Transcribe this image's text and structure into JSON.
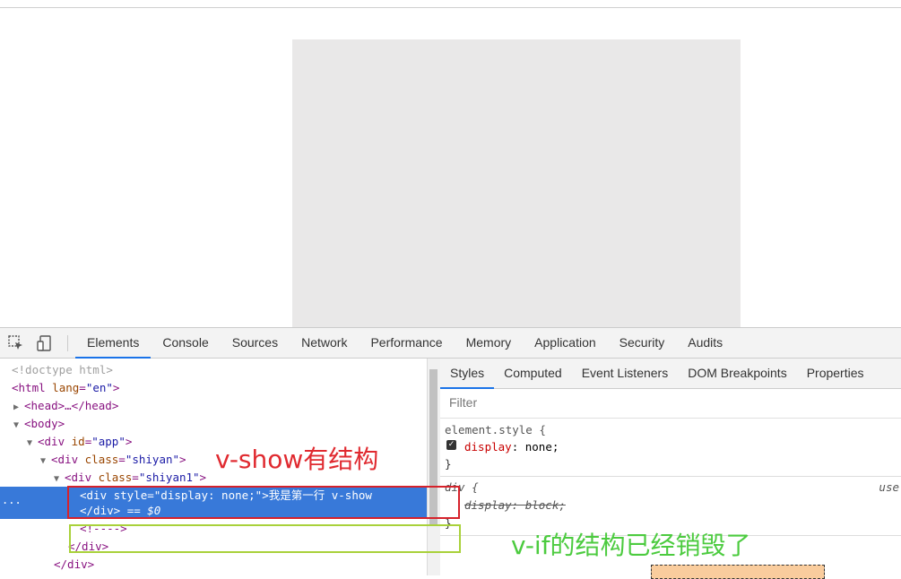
{
  "devtools": {
    "tabs": [
      "Elements",
      "Console",
      "Sources",
      "Network",
      "Performance",
      "Memory",
      "Application",
      "Security",
      "Audits"
    ],
    "active_tab": "Elements"
  },
  "elements_tree": {
    "doctype": "<!doctype html>",
    "html_open_tag": "html",
    "html_lang_attr": "lang",
    "html_lang_val": "\"en\"",
    "head_line": "<head>…</head>",
    "body_tag": "<body>",
    "app_tag": "div",
    "app_attr": "id",
    "app_val": "\"app\"",
    "shiyan_tag": "div",
    "shiyan_attr": "class",
    "shiyan_val": "\"shiyan\"",
    "shiyan1_tag": "div",
    "shiyan1_attr": "class",
    "shiyan1_val": "\"shiyan1\"",
    "selected_open": "<div style=\"display: none;\">我是第一行   v-show",
    "selected_close": "</div>",
    "selected_marker": "== $0",
    "comment": "<!---->",
    "close_div_1": "</div>",
    "close_div_2": "</div>",
    "selected_dots": "..."
  },
  "styles_pane": {
    "subtabs": [
      "Styles",
      "Computed",
      "Event Listeners",
      "DOM Breakpoints",
      "Properties"
    ],
    "active_subtab": "Styles",
    "filter_placeholder": "Filter",
    "element_style_selector": "element.style {",
    "element_style_prop": "display",
    "element_style_value": "none;",
    "element_style_close": "}",
    "div_rule_selector": "div {",
    "div_rule_source": "use",
    "div_rule_prop": "display: block;",
    "div_rule_close": "}"
  },
  "annotations": {
    "vshow_label": "v-show有结构",
    "vif_label": "v-if的结构已经销毁了",
    "red_color": "#e02a30",
    "green_color": "#4ccb3f"
  },
  "icons": [
    "inspect-element-icon",
    "device-toolbar-icon"
  ]
}
